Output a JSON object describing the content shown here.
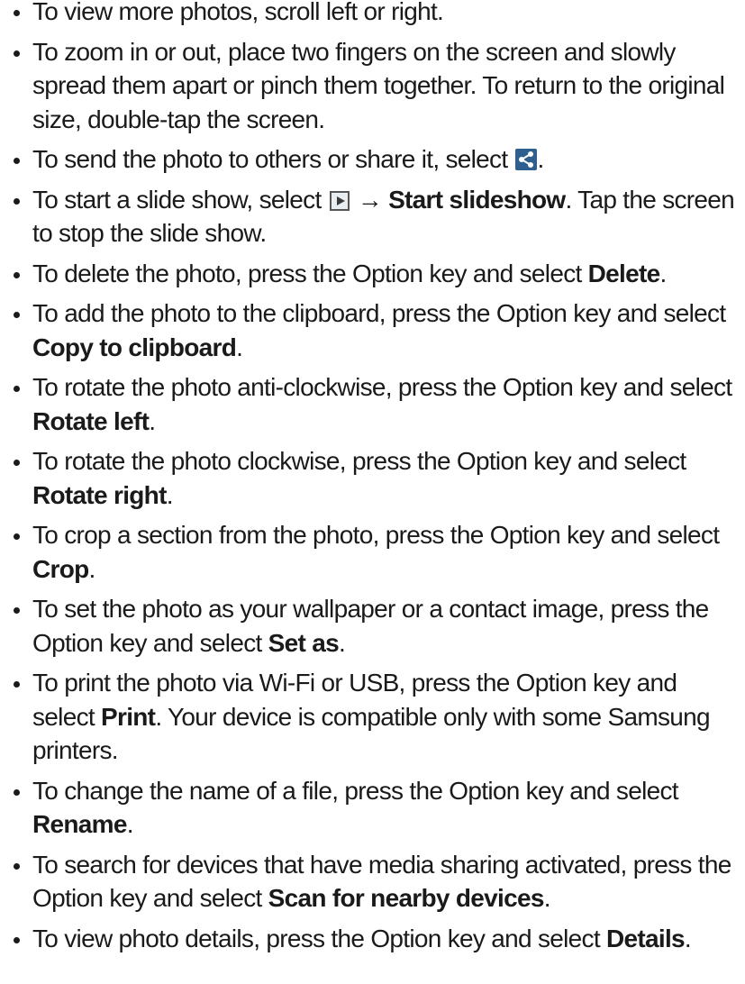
{
  "items": [
    {
      "text": "To view more photos, scroll left or right."
    },
    {
      "text": "To zoom in or out, place two fingers on the screen and slowly spread them apart or pinch them together. To return to the original size, double-tap the screen."
    },
    {
      "before": "To send the photo to others or share it, select ",
      "icon": "share-icon",
      "after": "."
    },
    {
      "before": "To start a slide show, select ",
      "icon": "play-icon",
      "arrow": " → ",
      "bold": "Start slideshow",
      "after": ". Tap the screen to stop the slide show."
    },
    {
      "before": "To delete the photo, press the Option key and select ",
      "bold": "Delete",
      "after": "."
    },
    {
      "before": "To add the photo to the clipboard, press the Option key and select ",
      "bold": "Copy to clipboard",
      "after": "."
    },
    {
      "before": "To rotate the photo anti-clockwise, press the Option key and select ",
      "bold": "Rotate left",
      "after": "."
    },
    {
      "before": "To rotate the photo clockwise, press the Option key and select ",
      "bold": "Rotate right",
      "after": "."
    },
    {
      "before": "To crop a section from the photo, press the Option key and select ",
      "bold": "Crop",
      "after": "."
    },
    {
      "before": "To set the photo as your wallpaper or a contact image, press the Option key and select ",
      "bold": "Set as",
      "after": "."
    },
    {
      "before": "To print the photo via Wi-Fi or USB, press the Option key and select ",
      "bold": "Print",
      "after": ". Your device is compatible only with some Samsung printers."
    },
    {
      "before": "To change the name of a file, press the Option key and select ",
      "bold": "Rename",
      "after": "."
    },
    {
      "before": "To search for devices that have media sharing activated, press the Option key and select ",
      "bold": "Scan for nearby devices",
      "after": "."
    },
    {
      "before": "To view photo details, press the Option key and select ",
      "bold": "Details",
      "after": "."
    }
  ],
  "colors": {
    "text": "#1a1a1a",
    "share_icon_bg": "#2f5f8f"
  }
}
